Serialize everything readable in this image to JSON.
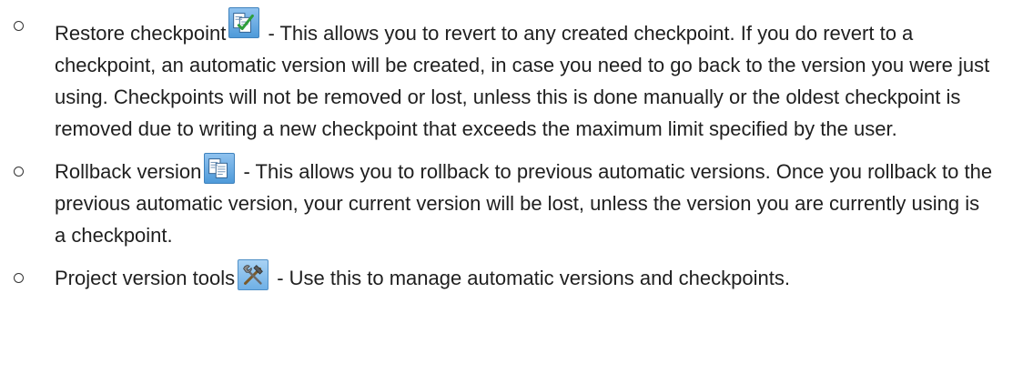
{
  "items": [
    {
      "label": "Restore checkpoint",
      "icon": "restore-checkpoint-icon",
      "text": " - This allows you to revert to any created checkpoint. If you do revert to a checkpoint, an automatic version will be created, in case you need to go back to the version you were just using. Checkpoints will not be removed or lost, unless this is done manually or the oldest checkpoint is removed due to writing a new checkpoint that exceeds the maximum limit specified by the user."
    },
    {
      "label": "Rollback version",
      "icon": "rollback-version-icon",
      "text": " - This allows you to rollback to previous automatic versions. Once you rollback to the previous automatic version, your current version will be lost, unless the version you are currently using is a checkpoint."
    },
    {
      "label": "Project version tools",
      "icon": "project-version-tools-icon",
      "text": " - Use this to manage automatic versions and checkpoints."
    }
  ],
  "colors": {
    "text": "#1f1f1f",
    "icon_blue": "#4e9ad9",
    "check_green": "#2e9e3a"
  }
}
